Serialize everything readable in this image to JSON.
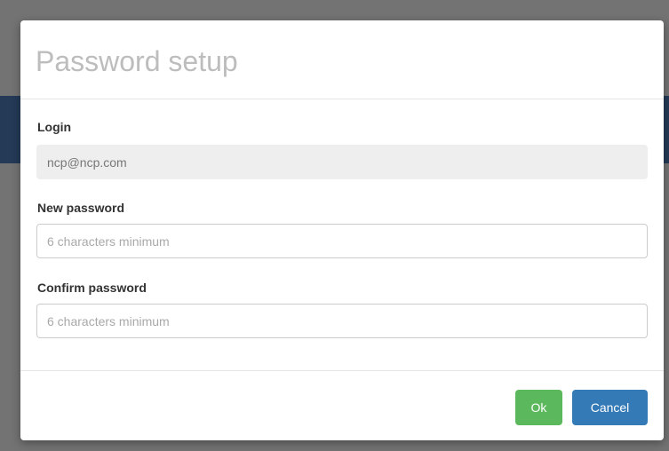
{
  "dialog": {
    "title": "Password setup",
    "login": {
      "label": "Login",
      "value": "ncp@ncp.com"
    },
    "new_password": {
      "label": "New password",
      "placeholder": "6 characters minimum",
      "value": ""
    },
    "confirm_password": {
      "label": "Confirm password",
      "placeholder": "6 characters minimum",
      "value": ""
    },
    "buttons": {
      "ok_label": "Ok",
      "cancel_label": "Cancel"
    }
  },
  "colors": {
    "ok_button": "#5cb85c",
    "cancel_button": "#337ab7",
    "backdrop": "#737373",
    "backdrop_band": "#243a57"
  }
}
